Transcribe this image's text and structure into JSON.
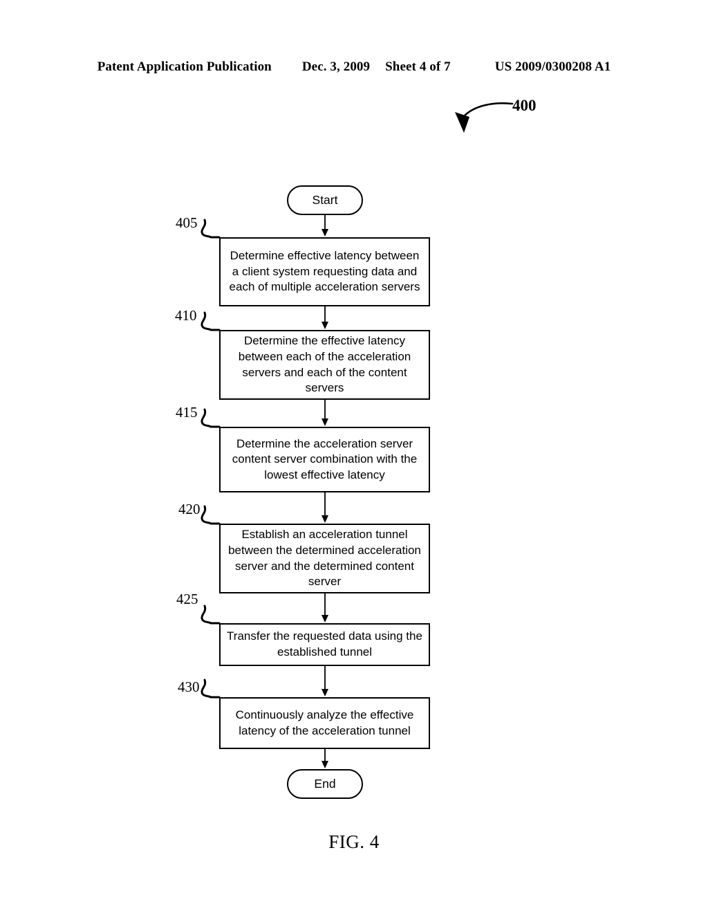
{
  "header": {
    "publication": "Patent Application Publication",
    "date": "Dec. 3, 2009",
    "sheet": "Sheet 4 of 7",
    "patent_number": "US 2009/0300208 A1"
  },
  "figure": {
    "reference_number": "400",
    "caption": "FIG. 4",
    "ink_color": "#000000",
    "background_color": "#ffffff"
  },
  "flowchart": {
    "start_label": "Start",
    "end_label": "End",
    "steps": [
      {
        "ref": "405",
        "text": "Determine effective latency between a client system requesting data and each of multiple acceleration servers"
      },
      {
        "ref": "410",
        "text": "Determine the effective latency between each of the acceleration servers and each of the content servers"
      },
      {
        "ref": "415",
        "text": "Determine the acceleration server content server combination with the lowest effective latency"
      },
      {
        "ref": "420",
        "text": "Establish an acceleration tunnel between the determined acceleration server and the determined content server"
      },
      {
        "ref": "425",
        "text": "Transfer the requested data using the established tunnel"
      },
      {
        "ref": "430",
        "text": "Continuously analyze the effective latency of the acceleration tunnel"
      }
    ]
  }
}
